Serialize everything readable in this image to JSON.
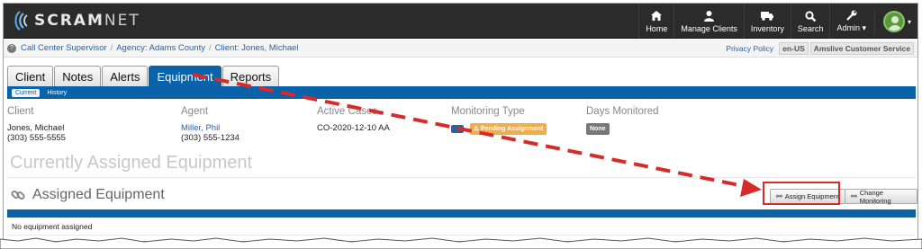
{
  "app": {
    "brand_main": "SCRAM",
    "brand_suffix": "NET"
  },
  "topnav": {
    "items": [
      {
        "label": "Home",
        "icon": "home-icon"
      },
      {
        "label": "Manage Clients",
        "icon": "user-icon"
      },
      {
        "label": "Inventory",
        "icon": "truck-icon"
      },
      {
        "label": "Search",
        "icon": "search-icon"
      },
      {
        "label": "Admin",
        "icon": "wrench-icon"
      }
    ],
    "admin_caret": "▾",
    "avatar_caret": "▾"
  },
  "breadcrumb": {
    "items": [
      "Call Center Supervisor",
      "Agency: Adams County",
      "Client: Jones, Michael"
    ],
    "privacy_link": "Privacy Policy",
    "locale": "en-US",
    "service": "Amslive Customer Service"
  },
  "tabs": {
    "items": [
      "Client",
      "Notes",
      "Alerts",
      "Equipment",
      "Reports"
    ],
    "active": "Equipment",
    "subtabs": [
      "Current",
      "History"
    ],
    "active_subtab": "Current"
  },
  "client_info": {
    "client": {
      "header": "Client",
      "name": "Jones, Michael",
      "phone": "(303) 555-5555"
    },
    "agent": {
      "header": "Agent",
      "name": "Miller, Phil",
      "phone": "(303) 555-1234"
    },
    "active_cases": {
      "header": "Active Cases",
      "value": "CO-2020-12-10 AA"
    },
    "monitoring_type": {
      "header": "Monitoring Type",
      "badge": "Pending Assignment",
      "badge_color": "#f0ad4e"
    },
    "days_monitored": {
      "header": "Days Monitored",
      "badge": "None"
    }
  },
  "page": {
    "title": "Currently Assigned Equipment",
    "section_title": "Assigned Equipment",
    "assign_button": "Assign Equipment",
    "change_button": "Change Monitoring",
    "empty_message": "No equipment assigned"
  },
  "colors": {
    "primary": "#0a62a9",
    "nav_bg": "#2b2b2b",
    "annotation": "#d62b2b"
  }
}
